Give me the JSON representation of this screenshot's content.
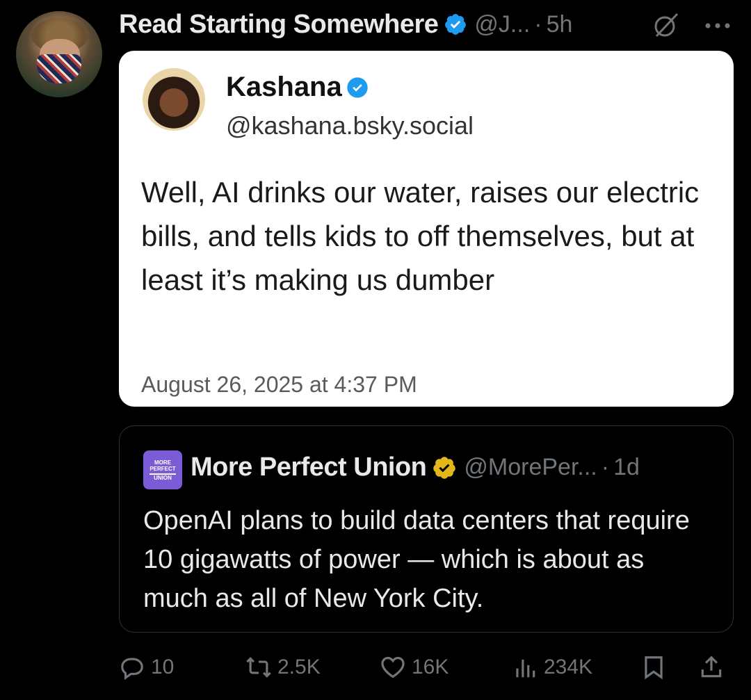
{
  "post": {
    "author_name": "Read Starting Somewhere",
    "author_handle": "@J...",
    "separator": "·",
    "time": "5h"
  },
  "screenshot_card": {
    "name": "Kashana",
    "handle": "@kashana.bsky.social",
    "text": "Well, AI drinks our water, raises our electric bills, and tells kids to off themselves, but at least it’s making us dumber",
    "date": "August 26, 2025 at 4:37 PM"
  },
  "quoted_post": {
    "logo_lines": [
      "MORE",
      "PERFECT",
      "UNION"
    ],
    "name": "More Perfect Union",
    "handle": "@MorePer...",
    "separator": "·",
    "time": "1d",
    "text": "OpenAI plans to build data centers that require 10 gigawatts of power — which is about as much as all of New York City."
  },
  "actions": {
    "replies": "10",
    "reposts": "2.5K",
    "likes": "16K",
    "views": "234K"
  },
  "colors": {
    "background": "#000000",
    "verified_blue": "#1d9bf0",
    "verified_gold": "#e2b719",
    "muted_text": "#71767b",
    "logo_purple": "#7b5bd6"
  },
  "icons": [
    "verified-badge-icon",
    "grok-icon",
    "more-icon",
    "reply-icon",
    "repost-icon",
    "like-icon",
    "views-icon",
    "bookmark-icon",
    "share-icon"
  ]
}
